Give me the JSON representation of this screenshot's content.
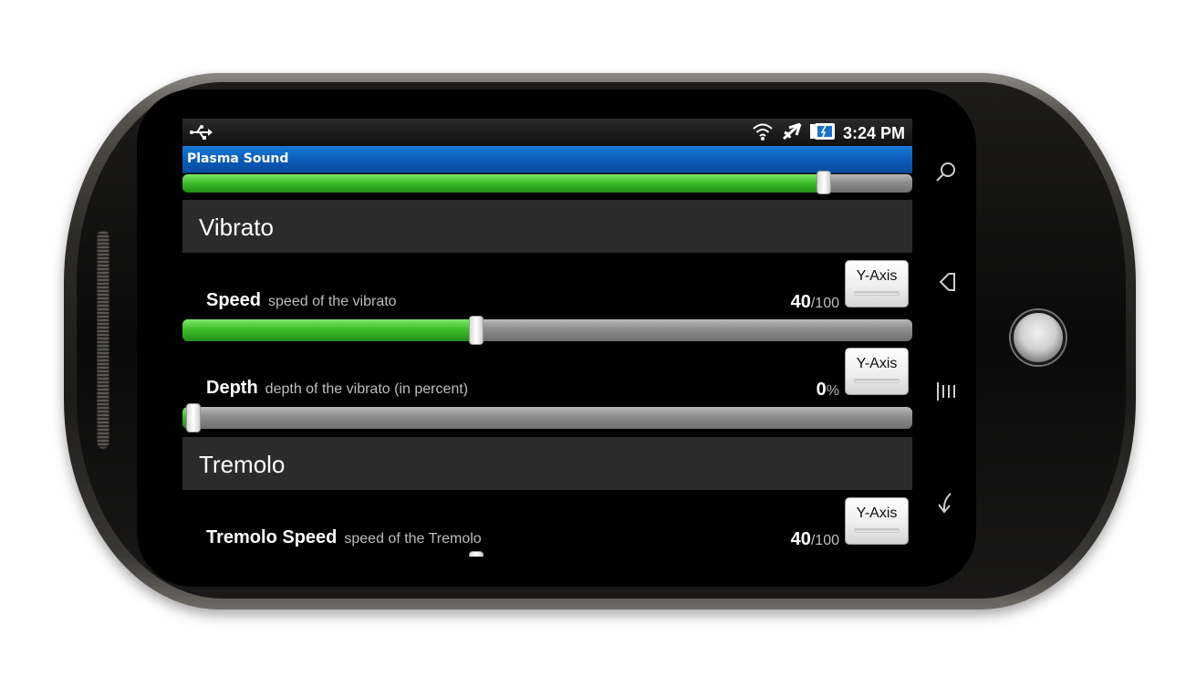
{
  "status_bar": {
    "time": "3:24 PM",
    "icons": [
      "usb-icon",
      "wifi-icon",
      "airplane-mode-icon",
      "battery-icon"
    ]
  },
  "app": {
    "title": "Plasma Sound"
  },
  "colors": {
    "title_bar": "#0a5bb7",
    "slider_fill": "#3fbf2a",
    "section_header_bg": "#2b2b2b"
  },
  "top_slider": {
    "value_fraction": 0.89
  },
  "sections": [
    {
      "header": "Vibrato",
      "prefs": [
        {
          "title": "Speed",
          "summary": "speed of the vibrato",
          "value": "40",
          "unit": "/100",
          "value_fraction": 0.4,
          "axis_button": "Y-Axis"
        },
        {
          "title": "Depth",
          "summary": "depth of the vibrato (in percent)",
          "value": "0",
          "unit": "%",
          "value_fraction": 0.0,
          "axis_button": "Y-Axis"
        }
      ]
    },
    {
      "header": "Tremolo",
      "prefs": [
        {
          "title": "Tremolo Speed",
          "summary": "speed of the Tremolo",
          "value": "40",
          "unit": "/100",
          "value_fraction": 0.4,
          "axis_button": "Y-Axis"
        }
      ]
    }
  ],
  "hardware_keys": [
    "search-key",
    "home-key",
    "menu-key",
    "back-key"
  ]
}
